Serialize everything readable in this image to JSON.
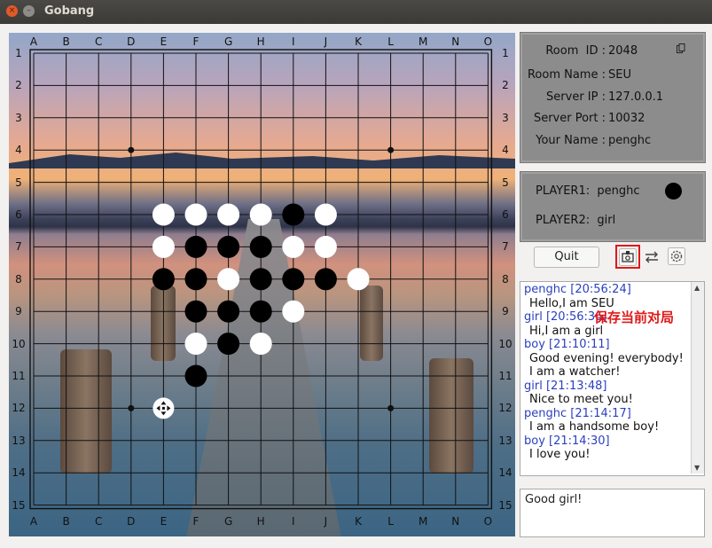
{
  "window": {
    "title": "Gobang",
    "close_glyph": "×",
    "min_glyph": "–"
  },
  "board": {
    "cols": [
      "A",
      "B",
      "C",
      "D",
      "E",
      "F",
      "G",
      "H",
      "I",
      "J",
      "K",
      "L",
      "M",
      "N",
      "O"
    ],
    "rows": [
      "1",
      "2",
      "3",
      "4",
      "5",
      "6",
      "7",
      "8",
      "9",
      "10",
      "11",
      "12",
      "13",
      "14",
      "15"
    ],
    "black_stones": [
      [
        "I",
        6
      ],
      [
        "F",
        7
      ],
      [
        "G",
        7
      ],
      [
        "H",
        7
      ],
      [
        "E",
        8
      ],
      [
        "F",
        8
      ],
      [
        "H",
        8
      ],
      [
        "I",
        8
      ],
      [
        "J",
        8
      ],
      [
        "F",
        9
      ],
      [
        "G",
        9
      ],
      [
        "H",
        9
      ],
      [
        "G",
        10
      ],
      [
        "F",
        11
      ]
    ],
    "white_stones": [
      [
        "E",
        6
      ],
      [
        "F",
        6
      ],
      [
        "G",
        6
      ],
      [
        "H",
        6
      ],
      [
        "J",
        6
      ],
      [
        "E",
        7
      ],
      [
        "I",
        7
      ],
      [
        "J",
        7
      ],
      [
        "G",
        8
      ],
      [
        "K",
        8
      ],
      [
        "I",
        9
      ],
      [
        "F",
        10
      ],
      [
        "H",
        10
      ]
    ],
    "star_points": [
      [
        "D",
        4
      ],
      [
        "L",
        4
      ],
      [
        "D",
        12
      ],
      [
        "L",
        12
      ]
    ],
    "cursor": [
      "E",
      12
    ]
  },
  "room_info": {
    "rows": [
      {
        "label": "Room  ID :",
        "value": "2048"
      },
      {
        "label": "Room Name :",
        "value": "SEU"
      },
      {
        "label": "Server IP :",
        "value": "127.0.0.1"
      },
      {
        "label": "Server Port :",
        "value": "10032"
      },
      {
        "label": "Your Name :",
        "value": "penghc"
      }
    ]
  },
  "players": {
    "p1_label": "PLAYER1:",
    "p1_name": "penghc",
    "p1_color": "black",
    "p2_label": "PLAYER2:",
    "p2_name": "girl"
  },
  "controls": {
    "quit_label": "Quit"
  },
  "chat": {
    "messages": [
      {
        "head": "penghc [20:56:24]",
        "body": "Hello,I am SEU"
      },
      {
        "head": "girl [20:56:36]",
        "body": "Hi,I am a girl"
      },
      {
        "head": "boy [21:10:11]",
        "body": "Good evening! everybody! I am a watcher!"
      },
      {
        "head": "girl [21:13:48]",
        "body": "Nice to meet you!"
      },
      {
        "head": "penghc [21:14:17]",
        "body": "I am a handsome boy!"
      },
      {
        "head": "boy [21:14:30]",
        "body": "I love you!"
      }
    ]
  },
  "input": {
    "value": "Good girl!"
  },
  "annotation": {
    "text": "保存当前对局",
    "color": "#e01818"
  }
}
